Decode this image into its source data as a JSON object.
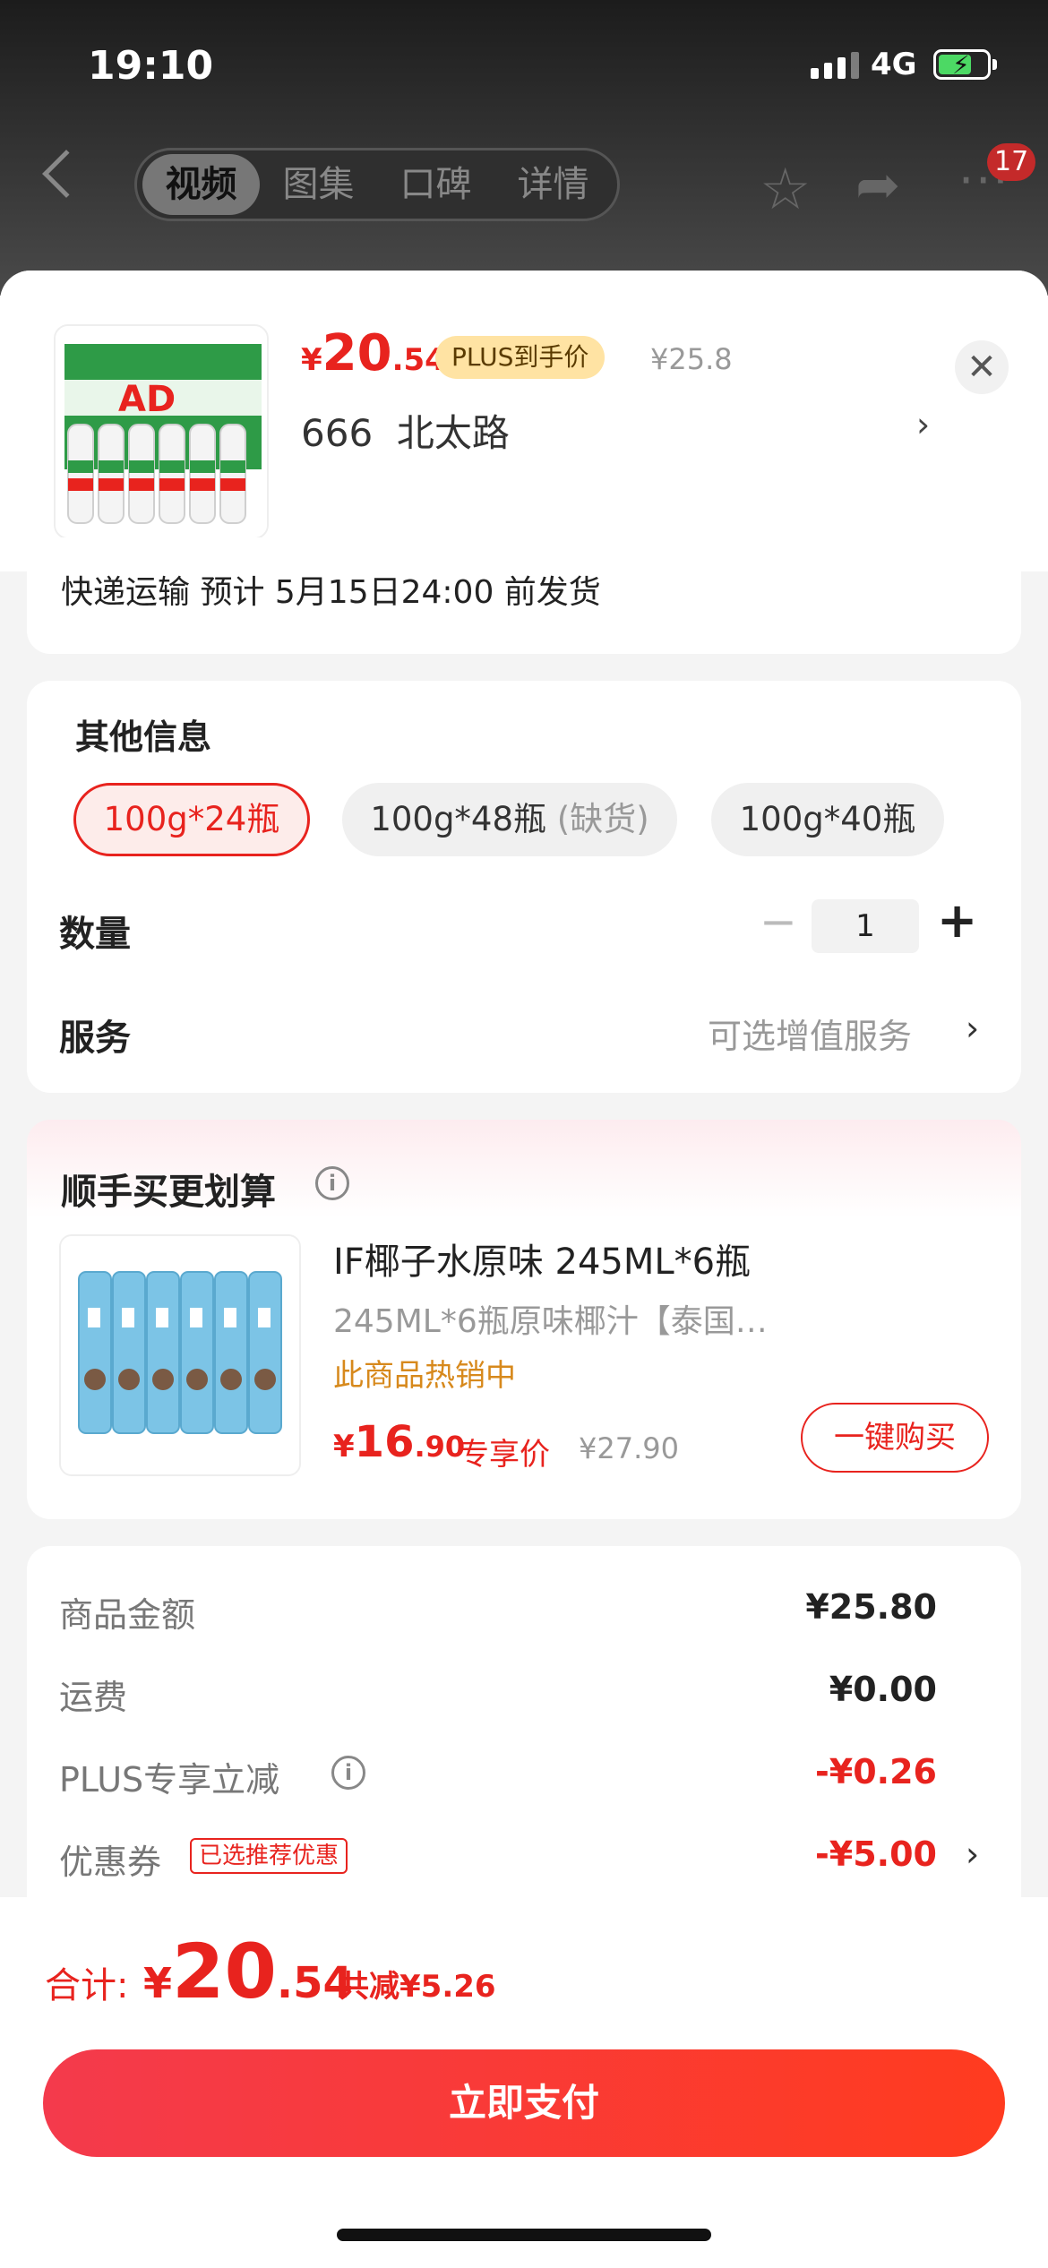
{
  "status_bar": {
    "time": "19:10",
    "network": "4G"
  },
  "nav": {
    "tabs": [
      "视频",
      "图集",
      "口碑",
      "详情"
    ],
    "active_tab": 0,
    "badge_count": "17"
  },
  "product": {
    "currency": "¥",
    "price_int": "20",
    "price_dec": ".54",
    "plus_tag": "PLUS到手价",
    "original_price": "¥25.8",
    "address": "666  北太路"
  },
  "shipping": {
    "text": "快递运输 预计 5月15日24:00 前发货"
  },
  "options": {
    "title": "其他信息",
    "specs": [
      {
        "label": "100g*24瓶",
        "note": "",
        "selected": true
      },
      {
        "label": "100g*48瓶",
        "note": "(缺货)",
        "selected": false
      },
      {
        "label": "100g*40瓶",
        "note": "",
        "selected": false
      }
    ],
    "quantity_label": "数量",
    "quantity": "1",
    "service_label": "服务",
    "service_value": "可选增值服务"
  },
  "bundle": {
    "title": "顺手买更划算",
    "name": "IF椰子水原味 245ML*6瓶",
    "desc": "245ML*6瓶原味椰汁【泰国…",
    "hot": "此商品热销中",
    "price_int": "16",
    "price_dec": ".90",
    "exclusive": "专享价",
    "original_price": "¥27.90",
    "buy_label": "一键购买"
  },
  "summary": {
    "rows": [
      {
        "label": "商品金额",
        "value": "¥25.80"
      },
      {
        "label": "运费",
        "value": "¥0.00"
      },
      {
        "label": "PLUS专享立减",
        "value": "-¥0.26"
      },
      {
        "label": "优惠券",
        "value": "-¥5.00"
      }
    ],
    "coupon_tag": "已选推荐优惠"
  },
  "footer": {
    "total_label": "合计:",
    "total_int": "20",
    "total_dec": ".54",
    "saved": "共减¥5.26",
    "pay_label": "立即支付"
  },
  "colors": {
    "accent": "#e8231e",
    "plus_tag_bg": "#ffe3a3",
    "hot": "#d7891c"
  }
}
